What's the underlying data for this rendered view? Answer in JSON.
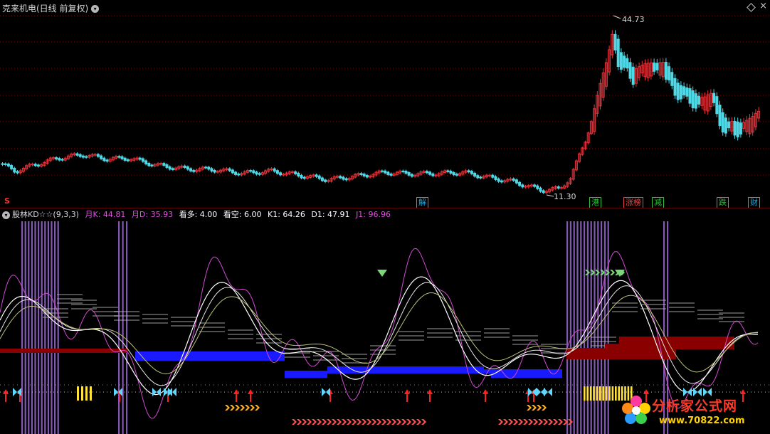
{
  "main": {
    "title": "克来机电(日线 前复权)",
    "high_label": "44.73",
    "low_label": "11.30",
    "s_marker": "S",
    "events": [
      {
        "label": "解",
        "color": "#22a7d6"
      },
      {
        "label": "港",
        "color": "#2fbf3c"
      },
      {
        "label": "涨榜",
        "color": "#e04a4a"
      },
      {
        "label": "减",
        "color": "#2fbf3c"
      },
      {
        "label": "跌",
        "color": "#2fbf3c"
      },
      {
        "label": "财",
        "color": "#22a7d6"
      }
    ]
  },
  "indicator": {
    "name": "股林KD☆☆(9,3,3)",
    "items": [
      {
        "label": "月K: 44.81",
        "color": "#e052e0"
      },
      {
        "label": "月D: 35.93",
        "color": "#e052e0"
      },
      {
        "label": "看多: 4.00",
        "color": "#ffffff"
      },
      {
        "label": "看空: 6.00",
        "color": "#ffffff"
      },
      {
        "label": "K1: 64.26",
        "color": "#ffffff"
      },
      {
        "label": "D1: 47.91",
        "color": "#ffffff"
      },
      {
        "label": "J1: 96.96",
        "color": "#e052e0"
      }
    ]
  },
  "watermark": {
    "text": "分析家公式网",
    "url": "www.70822.com"
  },
  "colors": {
    "up": "#e8333a",
    "down": "#4fd8e6",
    "k_line": "#ffffff",
    "j_line": "#d24ad2",
    "bull_band": "#1a1aff",
    "bear_band": "#8a0000",
    "stripes": "#9a6ad0"
  }
}
